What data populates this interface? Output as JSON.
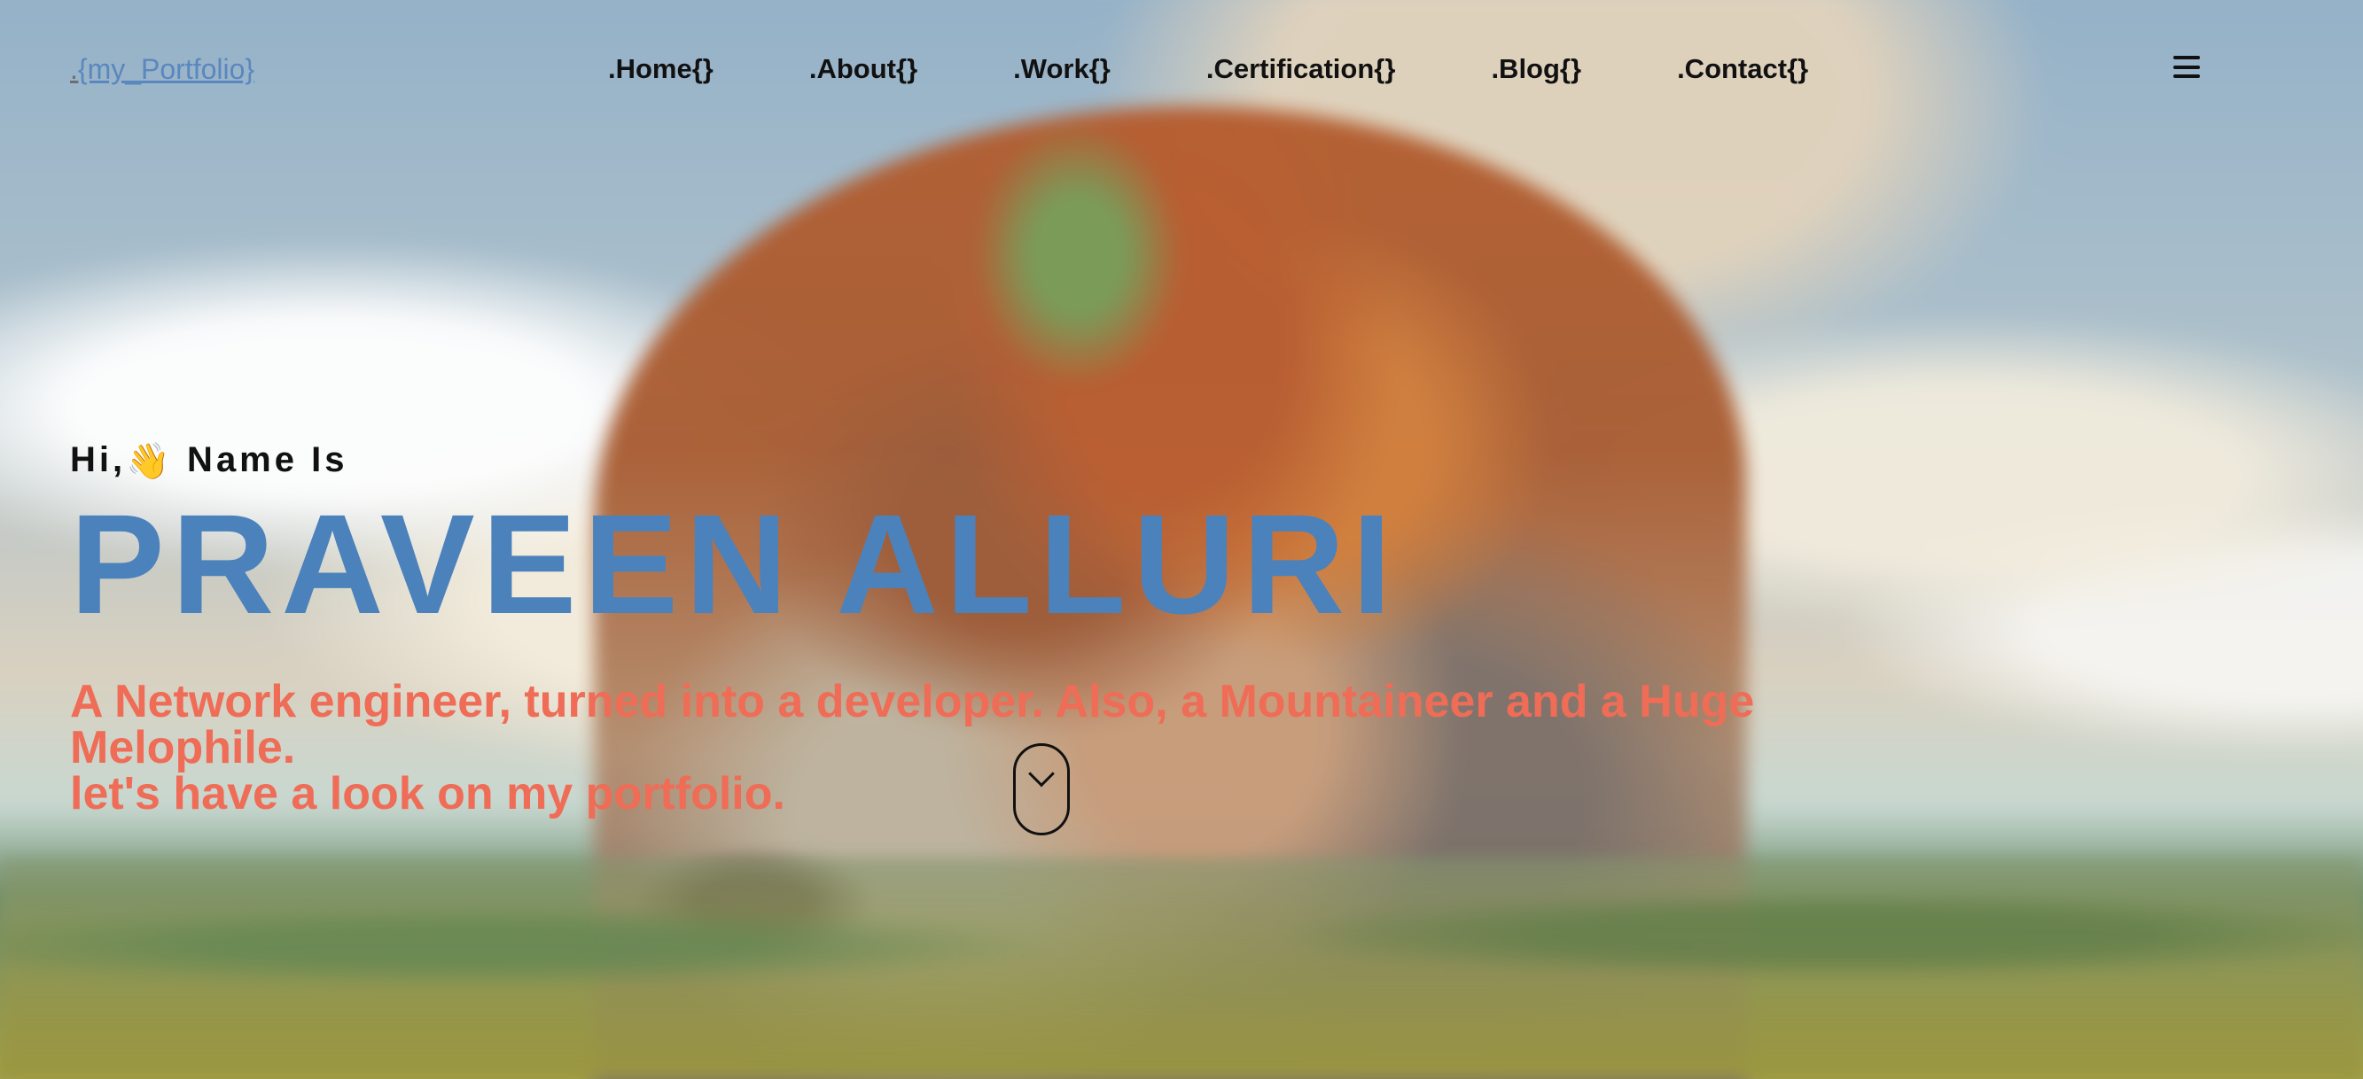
{
  "header": {
    "logo_prefix": ".",
    "logo_text": "{my_Portfolio}",
    "nav": [
      ".Home{}",
      ".About{}",
      ".Work{}",
      ".Certification{}",
      ".Blog{}",
      ".Contact{}"
    ],
    "menu_icon": "hamburger-icon"
  },
  "hero": {
    "greeting_prefix": "Hi,",
    "greeting_icon": "👋",
    "greeting_suffix": " Name Is",
    "name": "PRAVEEN ALLURI",
    "tagline_line1": "A Network engineer, turned into a developer. Also, a Mountaineer and a Huge Melophile.",
    "tagline_line2": "let's have a look on my portfolio."
  },
  "scroll": {
    "icon": "scroll-down-icon"
  },
  "colors": {
    "accent_blue": "#4b82bb",
    "accent_orange": "#ef6c57",
    "logo_link": "#5a87bf",
    "text_dark": "#111111"
  }
}
